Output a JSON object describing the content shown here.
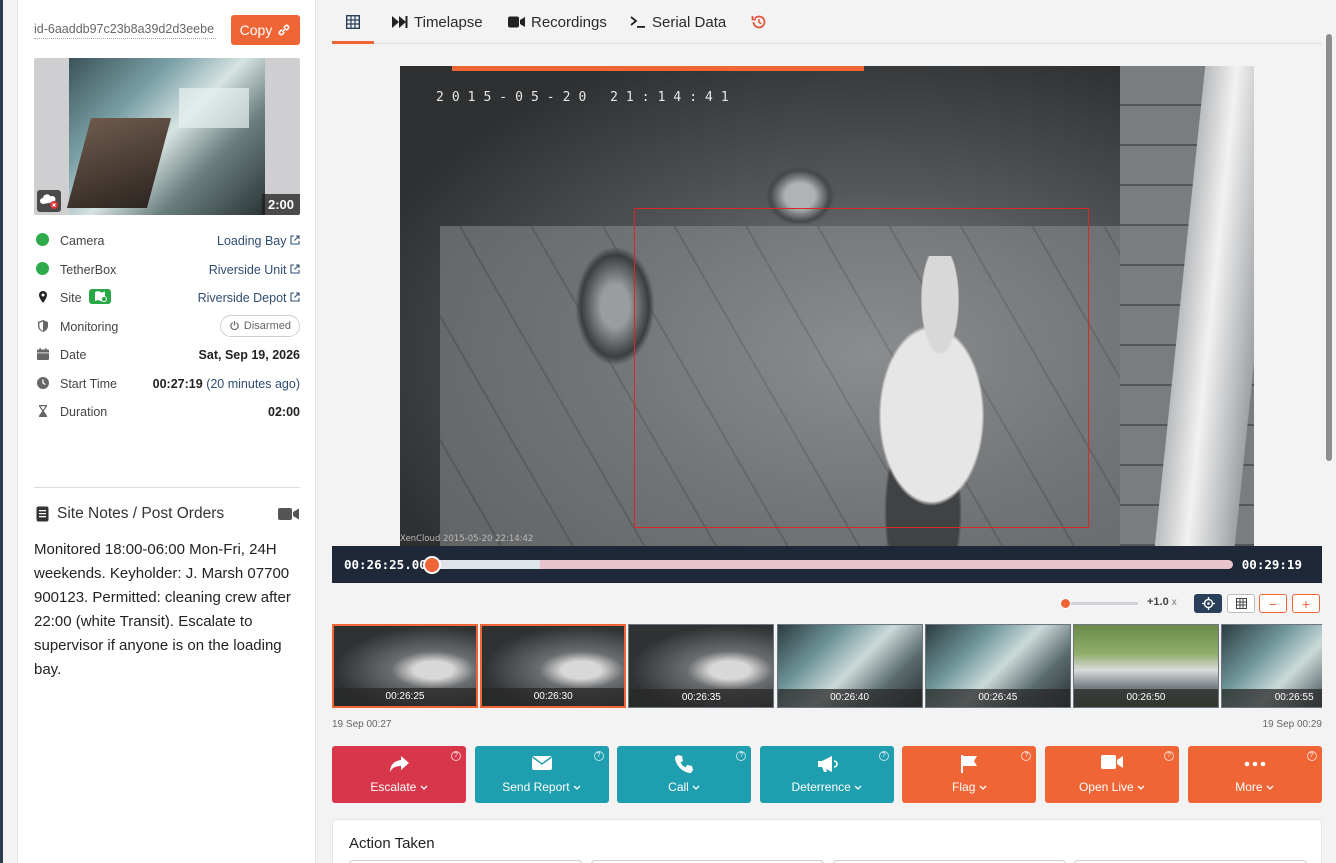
{
  "left_panel": {
    "event_id": "id-6aaddb97c23b8a39d2d3eebe",
    "copy_label": "Copy",
    "thumbnail_duration": "2:00",
    "info": {
      "camera_label": "Camera",
      "camera_value": "Loading Bay",
      "tetherbox_label": "TetherBox",
      "tetherbox_value": "Riverside Unit",
      "site_label": "Site",
      "site_value": "Riverside Depot",
      "monitoring_label": "Monitoring",
      "monitoring_value": "Disarmed",
      "date_label": "Date",
      "date_value": "Sat,  Sep 19,  2026",
      "start_label": "Start Time",
      "start_value": "00:27:19",
      "start_relative": "(20 minutes ago)",
      "duration_label": "Duration",
      "duration_value": "02:00"
    },
    "notes_title": "Site Notes / Post Orders",
    "notes_body": "Monitored 18:00-06:00 Mon-Fri, 24H weekends. Keyholder: J. Marsh 07700 900123. Permitted: cleaning crew after 22:00 (white Transit). Escalate to supervisor if anyone is on the loading bay."
  },
  "tabs": [
    {
      "label": "",
      "icon": "grid-icon"
    },
    {
      "label": "Timelapse",
      "icon": "fast-forward-icon"
    },
    {
      "label": "Recordings",
      "icon": "video-camera-icon"
    },
    {
      "label": "Serial Data",
      "icon": "terminal-icon"
    },
    {
      "label": "",
      "icon": "history-icon"
    }
  ],
  "video": {
    "osd_timestamp": "2015-05-20 21:14:41",
    "osd_footer": "XenCloud 2015-05-20 22:14:42"
  },
  "player": {
    "current_time": "00:26:25.00",
    "end_time": "00:29:19",
    "progress": 0.0,
    "buffered": 0.06,
    "speed": "+1.0",
    "speed_unit": "x"
  },
  "thumbnails": [
    {
      "time": "00:26:25",
      "kind": "night",
      "selected": true
    },
    {
      "time": "00:26:30",
      "kind": "night",
      "selected": true
    },
    {
      "time": "00:26:35",
      "kind": "night",
      "selected": false
    },
    {
      "time": "00:26:40",
      "kind": "kitchen",
      "selected": false
    },
    {
      "time": "00:26:45",
      "kind": "kitchen",
      "selected": false
    },
    {
      "time": "00:26:50",
      "kind": "street",
      "selected": false
    },
    {
      "time": "00:26:55",
      "kind": "kitchen",
      "selected": false
    }
  ],
  "timeline_start": "19 Sep 00:27",
  "timeline_end": "19 Sep 00:29",
  "actions": [
    {
      "label": "Escalate",
      "icon": "share-arrow-icon",
      "color": "#d8374b"
    },
    {
      "label": "Send Report",
      "icon": "envelope-icon",
      "color": "#1f9eaf"
    },
    {
      "label": "Call",
      "icon": "phone-icon",
      "color": "#1f9eaf"
    },
    {
      "label": "Deterrence",
      "icon": "megaphone-icon",
      "color": "#1f9eaf"
    },
    {
      "label": "Flag",
      "icon": "flag-icon",
      "color": "#ef6536"
    },
    {
      "label": "Open Live",
      "icon": "video-camera-icon",
      "color": "#ef6536"
    },
    {
      "label": "More",
      "icon": "ellipsis-icon",
      "color": "#ef6536"
    }
  ],
  "action_taken_title": "Action Taken",
  "colors": {
    "accent": "#ef6536",
    "teal": "#1f9eaf",
    "danger": "#d8374b",
    "ok": "#2eaa4a"
  }
}
